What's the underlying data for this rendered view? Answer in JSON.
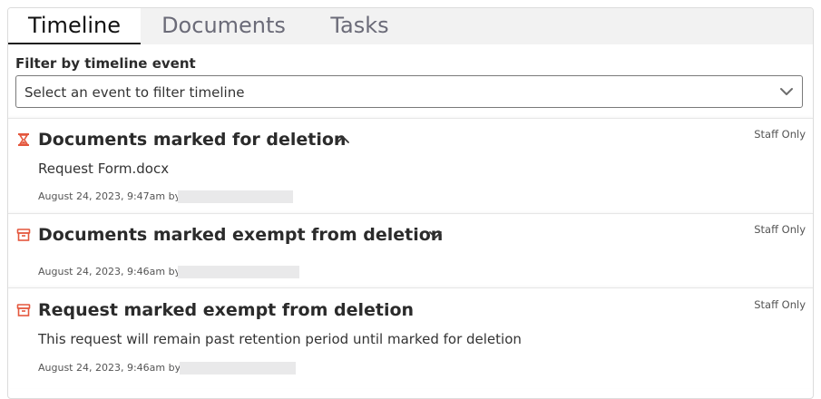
{
  "tabs": [
    {
      "label": "Timeline",
      "active": true
    },
    {
      "label": "Documents",
      "active": false
    },
    {
      "label": "Tasks",
      "active": false
    }
  ],
  "filter": {
    "label": "Filter by timeline event",
    "placeholder": "Select an event to filter timeline",
    "icon": "chevron-down-icon"
  },
  "events": [
    {
      "icon": "hourglass-icon",
      "title": "Documents marked for deletion",
      "toggle_icon": "chevron-up-icon",
      "expanded": true,
      "badge": "Staff Only",
      "body": "Request Form.docx",
      "meta": "August 24, 2023, 9:47am by"
    },
    {
      "icon": "archive-box-icon",
      "title": "Documents marked exempt from deletion",
      "toggle_icon": "chevron-down-icon",
      "expanded": false,
      "badge": "Staff Only",
      "body": "",
      "meta": "August 24, 2023, 9:46am by"
    },
    {
      "icon": "archive-box-icon",
      "title": "Request marked exempt from deletion",
      "badge": "Staff Only",
      "body": "This request will remain past retention period until marked for deletion",
      "meta": "August 24, 2023, 9:46am by"
    }
  ],
  "colors": {
    "icon_accent": "#e4573d",
    "active_tab_underline": "#1f1f1f",
    "tab_inactive": "#6b6b78"
  }
}
